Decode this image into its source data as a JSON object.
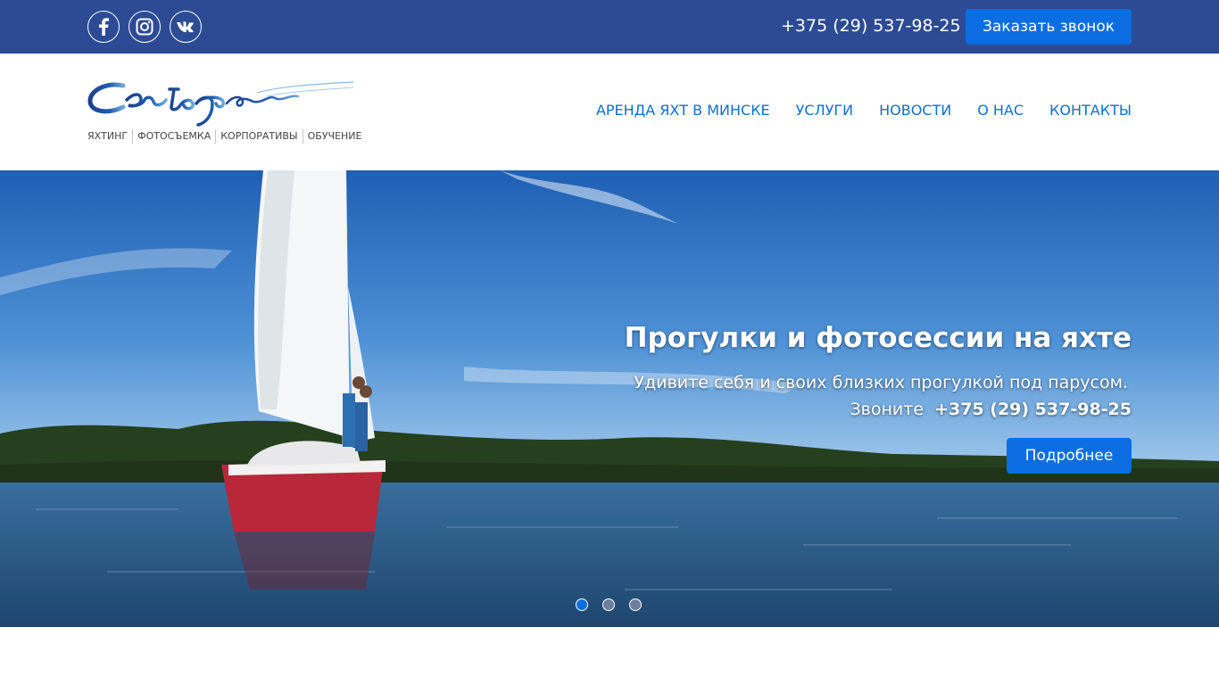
{
  "topbar": {
    "socials": [
      {
        "name": "facebook-icon",
        "glyph": "f"
      },
      {
        "name": "instagram-icon",
        "glyph": "instagram"
      },
      {
        "name": "vk-icon",
        "glyph": "vk"
      }
    ],
    "phone": "+375 (29) 537-98-25",
    "callback_label": "Заказать звонок",
    "color": "#2d4b94"
  },
  "header": {
    "tagline": [
      "ЯХТИНГ",
      "ФОТОСЪЕМКА",
      "КОРПОРАТИВЫ",
      "ОБУЧЕНИЕ"
    ],
    "nav": [
      "АРЕНДА ЯХТ В МИНСКЕ",
      "УСЛУГИ",
      "НОВОСТИ",
      "О НАС",
      "КОНТАКТЫ"
    ],
    "nav_color": "#0f6fd1"
  },
  "hero": {
    "title": "Прогулки и фотосессии на яхте",
    "subtitle": "Удивите себя и своих близких прогулкой под парусом.",
    "call_prefix": "Звоните",
    "call_phone": "+375 (29) 537-98-25",
    "button_label": "Подробнее",
    "slides_total": 3,
    "active_slide": 1,
    "button_color": "#0a6ee2"
  }
}
